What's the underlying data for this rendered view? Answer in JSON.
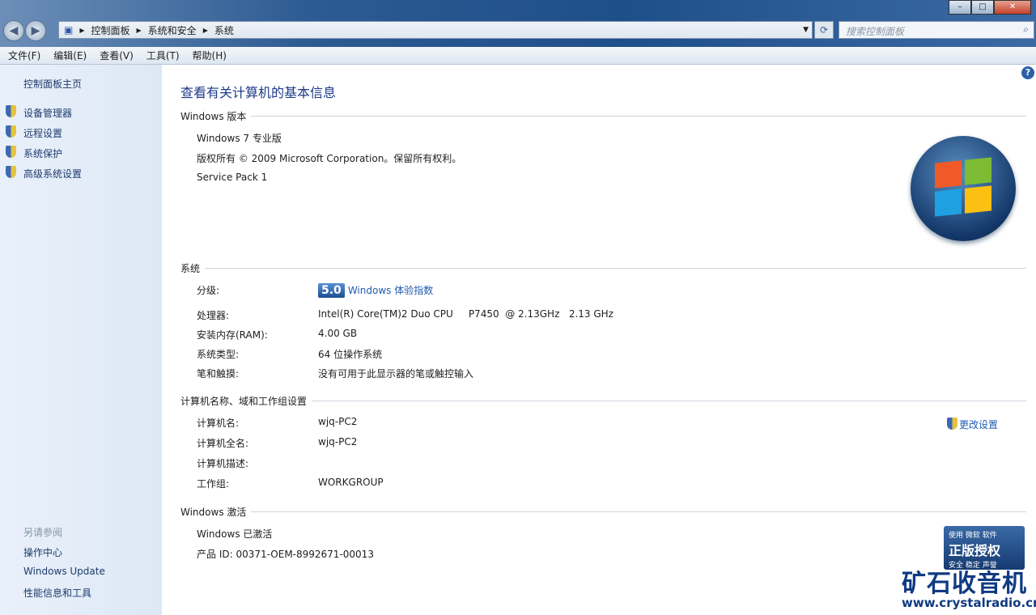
{
  "window": {
    "minimize": "–",
    "maximize": "□",
    "close": "✕"
  },
  "address": {
    "crumbs": [
      "控制面板",
      "系统和安全",
      "系统"
    ]
  },
  "search": {
    "placeholder": "搜索控制面板"
  },
  "menu": [
    "文件(F)",
    "编辑(E)",
    "查看(V)",
    "工具(T)",
    "帮助(H)"
  ],
  "sidebar": {
    "home": "控制面板主页",
    "tasks": [
      "设备管理器",
      "远程设置",
      "系统保护",
      "高级系统设置"
    ],
    "see_also_title": "另请参阅",
    "see_also": [
      "操作中心",
      "Windows Update",
      "性能信息和工具"
    ]
  },
  "main": {
    "title": "查看有关计算机的基本信息",
    "edition": {
      "header": "Windows 版本",
      "name": "Windows 7 专业版",
      "copyright": "版权所有 © 2009 Microsoft Corporation。保留所有权利。",
      "sp": "Service Pack 1"
    },
    "system": {
      "header": "系统",
      "rating_label": "分级:",
      "rating_score": "5.0",
      "rating_link": "Windows 体验指数",
      "rows": [
        {
          "label": "处理器:",
          "value": "Intel(R) Core(TM)2 Duo CPU     P7450  @ 2.13GHz   2.13 GHz"
        },
        {
          "label": "安装内存(RAM):",
          "value": "4.00 GB"
        },
        {
          "label": "系统类型:",
          "value": "64 位操作系统"
        },
        {
          "label": "笔和触摸:",
          "value": "没有可用于此显示器的笔或触控输入"
        }
      ]
    },
    "computer": {
      "header": "计算机名称、域和工作组设置",
      "change": "更改设置",
      "rows": [
        {
          "label": "计算机名:",
          "value": "wjq-PC2"
        },
        {
          "label": "计算机全名:",
          "value": "wjq-PC2"
        },
        {
          "label": "计算机描述:",
          "value": ""
        },
        {
          "label": "工作组:",
          "value": "WORKGROUP"
        }
      ]
    },
    "activation": {
      "header": "Windows 激活",
      "status": "Windows 已激活",
      "product_id": "产品 ID: 00371-OEM-8992671-00013"
    },
    "genuine": {
      "line1": "使用 微软 软件",
      "line2": "正版授权",
      "line3": "安全 稳定 声誉"
    }
  },
  "watermark": {
    "text": "矿石收音机",
    "url": "www.crystalradio.cn"
  }
}
